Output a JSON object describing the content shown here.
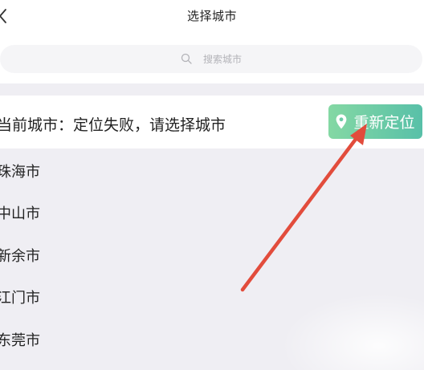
{
  "header": {
    "title": "选择城市",
    "back_icon": "chevron-left-icon"
  },
  "search": {
    "placeholder": "搜索城市",
    "icon": "search-icon"
  },
  "current_city": {
    "text": "当前城市：定位失败，请选择城市",
    "relocate_label": "重新定位",
    "relocate_icon": "location-pin-icon"
  },
  "cities": [
    "珠海市",
    "中山市",
    "新余市",
    "江门市",
    "东莞市"
  ],
  "colors": {
    "accent_start": "#84d8a4",
    "accent_end": "#58c0a8",
    "annotation_arrow": "#e24c3c",
    "list_background": "#efeef3"
  }
}
